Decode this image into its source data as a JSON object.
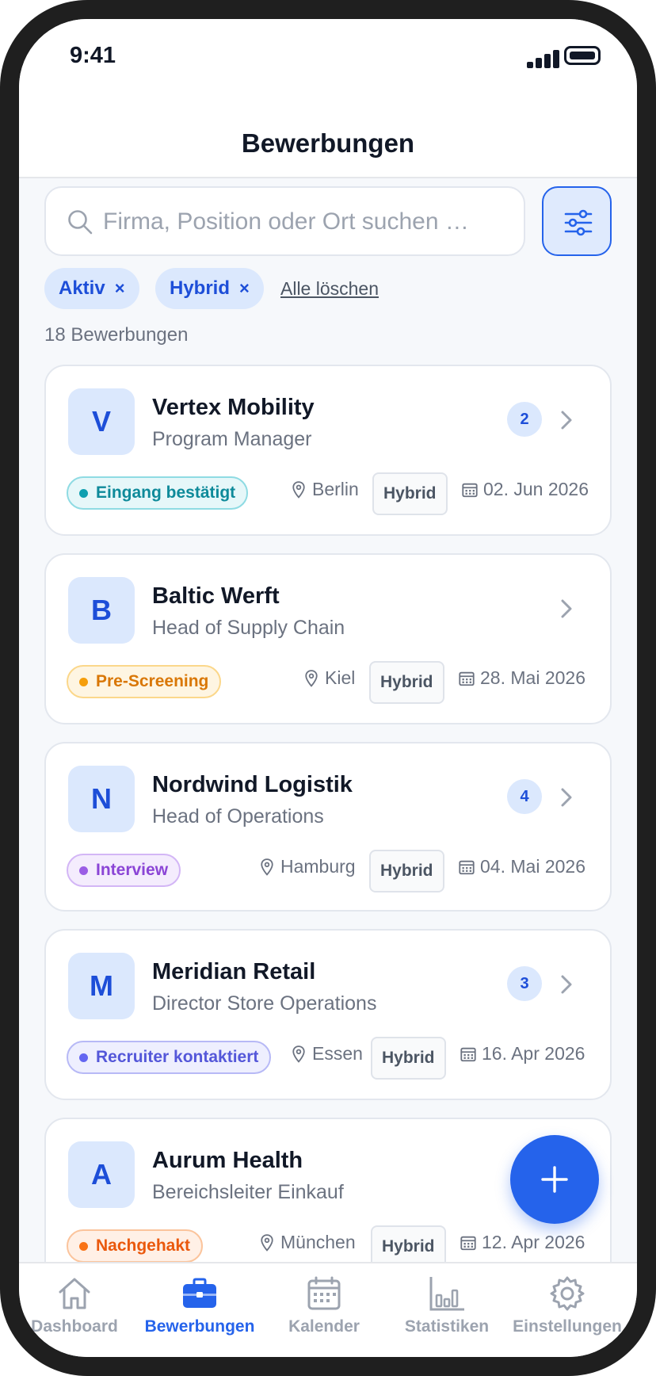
{
  "status_bar": {
    "time": "9:41"
  },
  "header": {
    "title": "Bewerbungen"
  },
  "search": {
    "placeholder": "Firma, Position oder Ort suchen …"
  },
  "filters": {
    "chips": [
      {
        "label": "Aktiv",
        "remove": "×"
      },
      {
        "label": "Hybrid",
        "remove": "×"
      }
    ],
    "clear_all": "Alle löschen"
  },
  "results": {
    "count_label": "18 Bewerbungen"
  },
  "applications": [
    {
      "initial": "V",
      "company": "Vertex Mobility",
      "role": "Program Manager",
      "badge": "2",
      "status": "Eingang bestätigt",
      "status_color": "#0e9fb0",
      "location": "Berlin",
      "work_mode": "Hybrid",
      "date": "02. Jun 2026"
    },
    {
      "initial": "B",
      "company": "Baltic Werft",
      "role": "Head of Supply Chain",
      "badge": "",
      "status": "Pre-Screening",
      "status_color": "#f59e0b",
      "location": "Kiel",
      "work_mode": "Hybrid",
      "date": "28. Mai 2026"
    },
    {
      "initial": "N",
      "company": "Nordwind Logistik",
      "role": "Head of Operations",
      "badge": "4",
      "status": "Interview",
      "status_color": "#9b5de5",
      "location": "Hamburg",
      "work_mode": "Hybrid",
      "date": "04. Mai 2026"
    },
    {
      "initial": "M",
      "company": "Meridian Retail",
      "role": "Director Store Operations",
      "badge": "3",
      "status": "Recruiter kontaktiert",
      "status_color": "#6366f1",
      "location": "Essen",
      "work_mode": "Hybrid",
      "date": "16. Apr 2026"
    },
    {
      "initial": "A",
      "company": "Aurum Health",
      "role": "Bereichsleiter Einkauf",
      "badge": "",
      "status": "Nachgehakt",
      "status_color": "#f97316",
      "location": "München",
      "work_mode": "Hybrid",
      "date": "12. Apr 2026"
    }
  ],
  "fab": {
    "icon": "plus-icon"
  },
  "bottom_nav": {
    "items": [
      {
        "label": "Dashboard",
        "icon": "home-icon"
      },
      {
        "label": "Bewerbungen",
        "icon": "briefcase-icon",
        "active": true
      },
      {
        "label": "Kalender",
        "icon": "calendar-icon"
      },
      {
        "label": "Statistiken",
        "icon": "bar-chart-icon"
      },
      {
        "label": "Einstellungen",
        "icon": "gear-icon"
      }
    ]
  },
  "colors": {
    "accent": "#2563eb",
    "accent_light": "#dbe8fd",
    "text": "#111827",
    "muted": "#6b7280"
  }
}
